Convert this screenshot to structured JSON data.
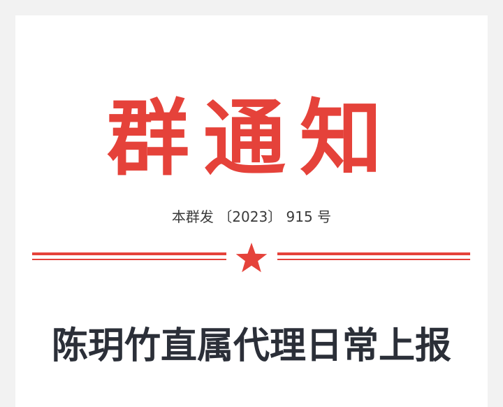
{
  "header": {
    "headline": "群通知",
    "doc_number": "本群发 〔2023〕 915 号",
    "emblem_icon": "star-icon"
  },
  "document": {
    "title": "陈玥竹直属代理日常上报"
  },
  "colors": {
    "accent_red": "#e5423a",
    "title_text": "#2b2f38",
    "body_text": "#3a3a3a",
    "paper": "#ffffff",
    "background": "#f2f2f2"
  }
}
